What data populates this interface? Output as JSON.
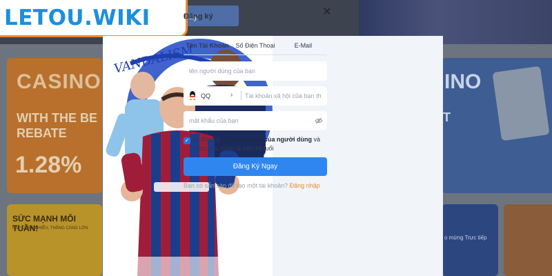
{
  "logo": {
    "text": "LETOU.WIKI"
  },
  "background": {
    "topbar_button": "ay",
    "casino_card": {
      "title": "CASINO",
      "subtitle": "WITH THE BE REBATE",
      "rate": "1.28%"
    },
    "promo_card": {
      "title": "SỨC MẠNH MỖI TUẦN!",
      "subtitle": "NẠP CÀNG NHIỀU, THẮNG CÀNG LỚN"
    },
    "right_card": {
      "title": "INO",
      "subtitle": "T"
    },
    "right_bottom": {
      "text": "o mừng Trực tiếp"
    }
  },
  "modal": {
    "title": "Đăng ký",
    "tabs": [
      {
        "label": "Tên Tài Khoản",
        "active": true
      },
      {
        "label": "Số Điện Thoại",
        "active": false
      },
      {
        "label": "E-Mail",
        "active": false
      }
    ],
    "username": {
      "placeholder": "tên người dùng của bạn"
    },
    "social": {
      "selected": "QQ",
      "placeholder": "Tài khoản xã hội của bạn th"
    },
    "password": {
      "placeholder": "mật khẩu của bạn"
    },
    "agree": {
      "prefix": "tôi đồng ý ",
      "link": "sự thỏa thuận của người dùng",
      "suffix": " và được xác nhận là trên 18 tuổi"
    },
    "submit_label": "Đăng Ký Ngay",
    "login_prompt": "Bạn có sẵn sàn để tạo một tài khoản?",
    "login_link": "Đăng nhập",
    "art_text": "VANDALISM"
  },
  "colors": {
    "accent": "#2f86f0",
    "logo_blue": "#1c8fde",
    "logo_border": "#f08a2e",
    "link_orange": "#f08a2e"
  }
}
